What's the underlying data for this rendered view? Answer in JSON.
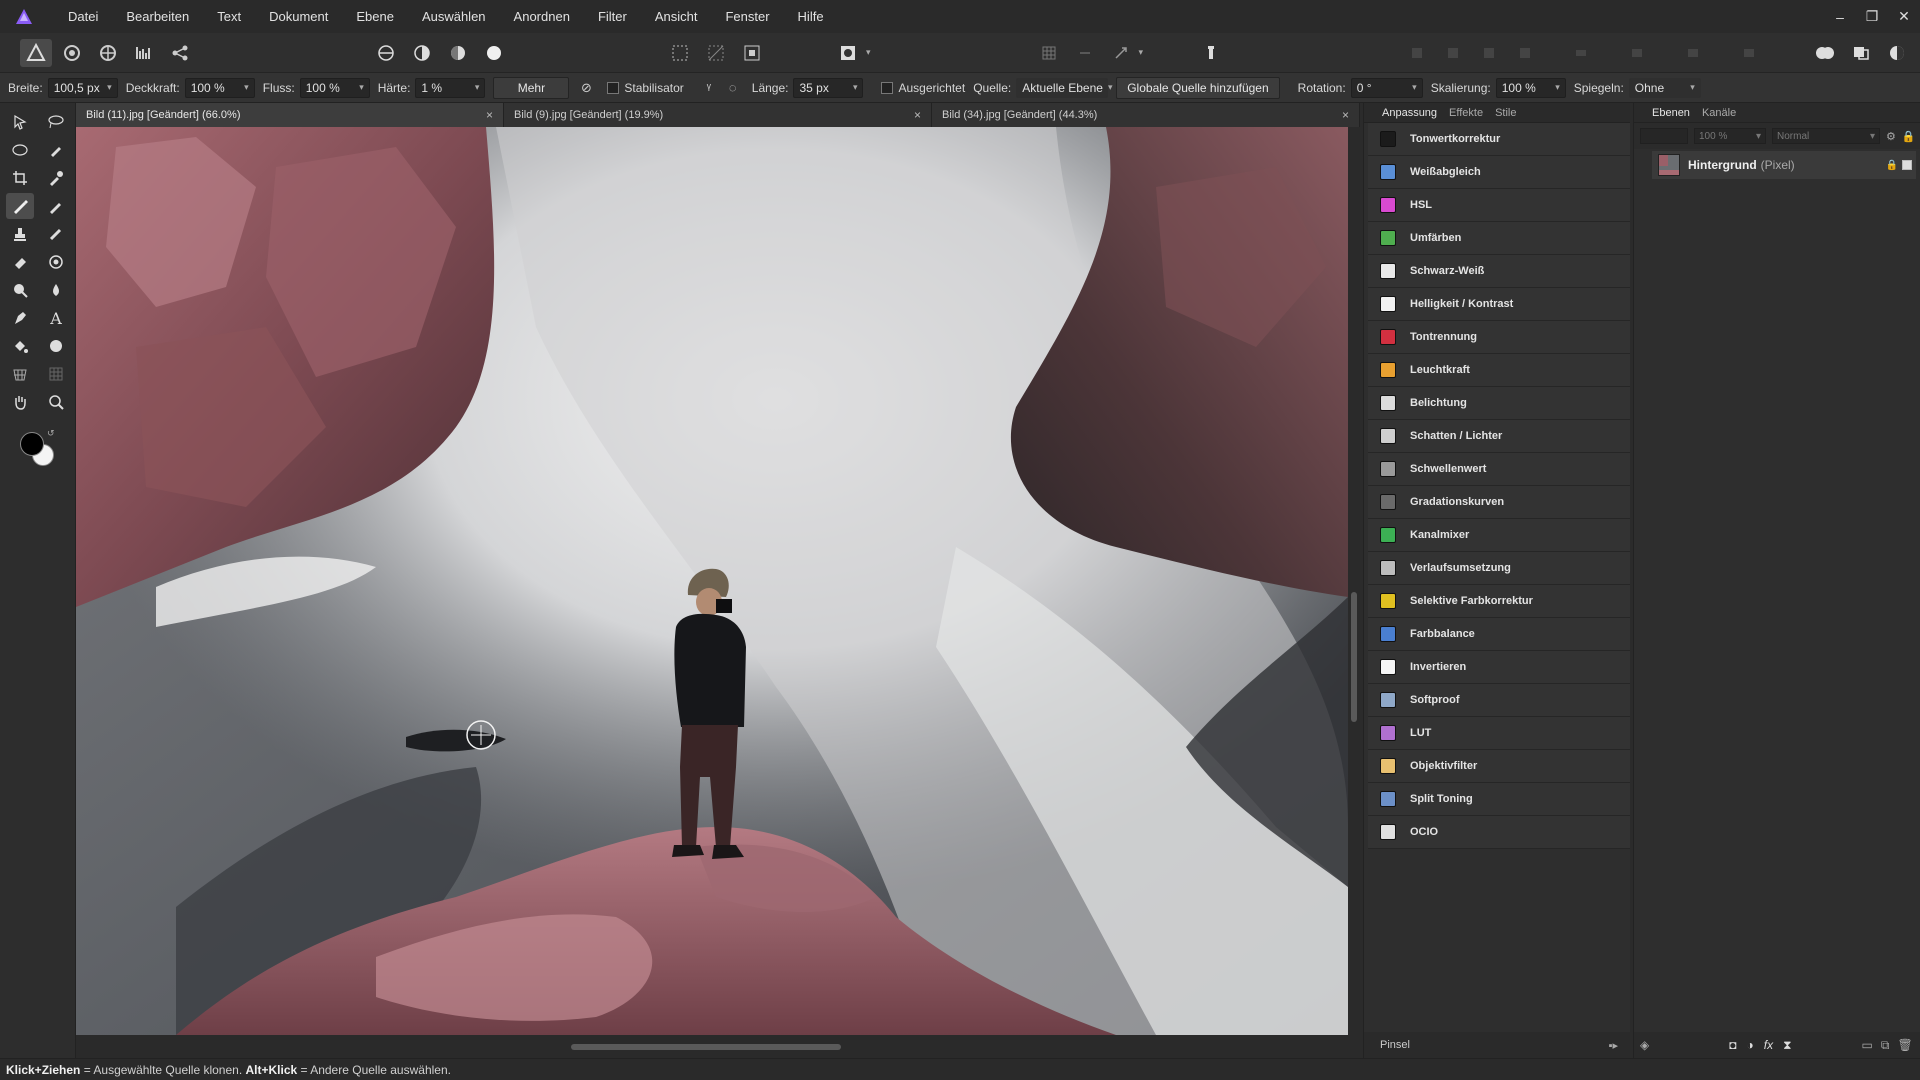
{
  "menu": [
    "Datei",
    "Bearbeiten",
    "Text",
    "Dokument",
    "Ebene",
    "Auswählen",
    "Anordnen",
    "Filter",
    "Ansicht",
    "Fenster",
    "Hilfe"
  ],
  "context": {
    "breite_label": "Breite:",
    "breite_value": "100,5 px",
    "deckkraft_label": "Deckkraft:",
    "deckkraft_value": "100 %",
    "fluss_label": "Fluss:",
    "fluss_value": "100 %",
    "haerte_label": "Härte:",
    "haerte_value": "1 %",
    "mehr_label": "Mehr",
    "stabilisator_label": "Stabilisator",
    "laenge_label": "Länge:",
    "laenge_value": "35 px",
    "ausgerichtet_label": "Ausgerichtet",
    "quelle_label": "Quelle:",
    "quelle_value": "Aktuelle Ebene",
    "globale_quelle_label": "Globale Quelle hinzufügen",
    "rotation_label": "Rotation:",
    "rotation_value": "0 °",
    "skalierung_label": "Skalierung:",
    "skalierung_value": "100 %",
    "spiegeln_label": "Spiegeln:",
    "spiegeln_value": "Ohne"
  },
  "tabs": [
    {
      "label": "Bild (11).jpg [Geändert] (66.0%)",
      "close": "×"
    },
    {
      "label": "Bild (9).jpg [Geändert] (19.9%)",
      "close": "×"
    },
    {
      "label": "Bild (34).jpg [Geändert] (44.3%)",
      "close": "×"
    }
  ],
  "adjust_panel": {
    "tabs": [
      "Anpassung",
      "Effekte",
      "Stile"
    ],
    "items": [
      {
        "label": "Tonwertkorrektur",
        "color": "#1b1b1b"
      },
      {
        "label": "Weißabgleich",
        "color": "#5a8fd6"
      },
      {
        "label": "HSL",
        "color": "#d94ad0"
      },
      {
        "label": "Umfärben",
        "color": "#4fae4f"
      },
      {
        "label": "Schwarz-Weiß",
        "color": "#e8e8e8"
      },
      {
        "label": "Helligkeit / Kontrast",
        "color": "#f2f2f2"
      },
      {
        "label": "Tontrennung",
        "color": "#d23040"
      },
      {
        "label": "Leuchtkraft",
        "color": "#e8a030"
      },
      {
        "label": "Belichtung",
        "color": "#dcdcdc"
      },
      {
        "label": "Schatten / Lichter",
        "color": "#cfcfcf"
      },
      {
        "label": "Schwellenwert",
        "color": "#9a9a9a"
      },
      {
        "label": "Gradationskurven",
        "color": "#6a6a6a"
      },
      {
        "label": "Kanalmixer",
        "color": "#3cb054"
      },
      {
        "label": "Verlaufsumsetzung",
        "color": "#bdbdbd"
      },
      {
        "label": "Selektive Farbkorrektur",
        "color": "#e0c020"
      },
      {
        "label": "Farbbalance",
        "color": "#4a7fd0"
      },
      {
        "label": "Invertieren",
        "color": "#f5f5f5"
      },
      {
        "label": "Softproof",
        "color": "#8fa8c8"
      },
      {
        "label": "LUT",
        "color": "#b070d0"
      },
      {
        "label": "Objektivfilter",
        "color": "#e8c070"
      },
      {
        "label": "Split Toning",
        "color": "#6c90c8"
      },
      {
        "label": "OCIO",
        "color": "#e0e0e0"
      }
    ],
    "footer": "Pinsel"
  },
  "layers_panel": {
    "tabs": [
      "Ebenen",
      "Kanäle"
    ],
    "opacity_value": "100 %",
    "blend_value": "Normal",
    "layer_name": "Hintergrund",
    "layer_type": "(Pixel)"
  },
  "status": {
    "bold1": "Klick+Ziehen",
    "text1": " = Ausgewählte Quelle klonen. ",
    "bold2": "Alt+Klick",
    "text2": " = Andere Quelle auswählen."
  }
}
